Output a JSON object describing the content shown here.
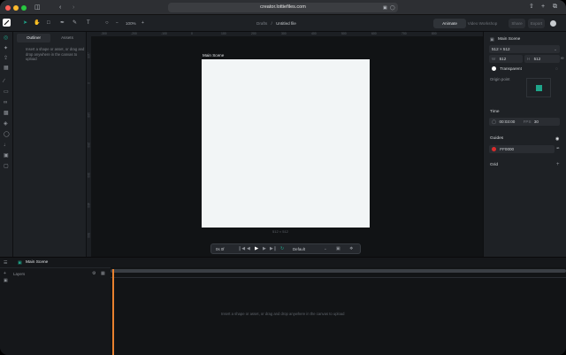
{
  "browser": {
    "url": "creator.lottiefiles.com",
    "icons": [
      "sidebar-icon",
      "back-icon",
      "forward-icon",
      "translate-icon",
      "shield-icon",
      "share-icon",
      "new-tab-icon",
      "tabs-icon"
    ]
  },
  "toolbar": {
    "zoom": "100%",
    "zoom_minus": "−",
    "zoom_plus": "+",
    "breadcrumb_folder": "Drafts",
    "breadcrumb_sep": "/",
    "file_name": "Untitled file",
    "mode_tabs": [
      {
        "label": "Animate"
      },
      {
        "label": "Video Workshop"
      }
    ],
    "share_label": "Share",
    "export_label": "Export"
  },
  "left_panel": {
    "tabs": [
      {
        "label": "Outliner"
      },
      {
        "label": "Assets"
      }
    ],
    "hint": "Insert a shape or asset, or drag and drop anywhere in the canvas to upload"
  },
  "canvas": {
    "artboard_label": "Main Scene",
    "size_label": "512 × 512",
    "ruler_top": [
      "-300",
      "-200",
      "-100",
      "0",
      "100",
      "200",
      "300",
      "400",
      "500",
      "600",
      "700",
      "800"
    ],
    "ruler_left": [
      "-100",
      "0",
      "100",
      "200",
      "300",
      "400",
      "500"
    ]
  },
  "playback": {
    "frame": "0s 0f",
    "speed": "Default"
  },
  "right_panel": {
    "title": "Main Scene",
    "preset": "512 × 512",
    "width_label": "W",
    "width": "512",
    "height_label": "H",
    "height": "512",
    "background": "Transparent",
    "origin_label": "Origin point",
    "time_label": "Time",
    "time_value": "00:03:00",
    "fps_label": "FPS",
    "fps": "30",
    "guides_label": "Guides",
    "guide_color": "FF0000",
    "grid_label": "Grid",
    "grid_add": "+"
  },
  "timeline": {
    "tab": "Main Scene",
    "layers_label": "Layers",
    "empty_hint": "Insert a shape or asset, or drag and drop anywhere in the canvas to upload"
  },
  "colors": {
    "accent": "#1fa58a",
    "playhead": "#e8812f",
    "guide": "#d92c2c"
  }
}
